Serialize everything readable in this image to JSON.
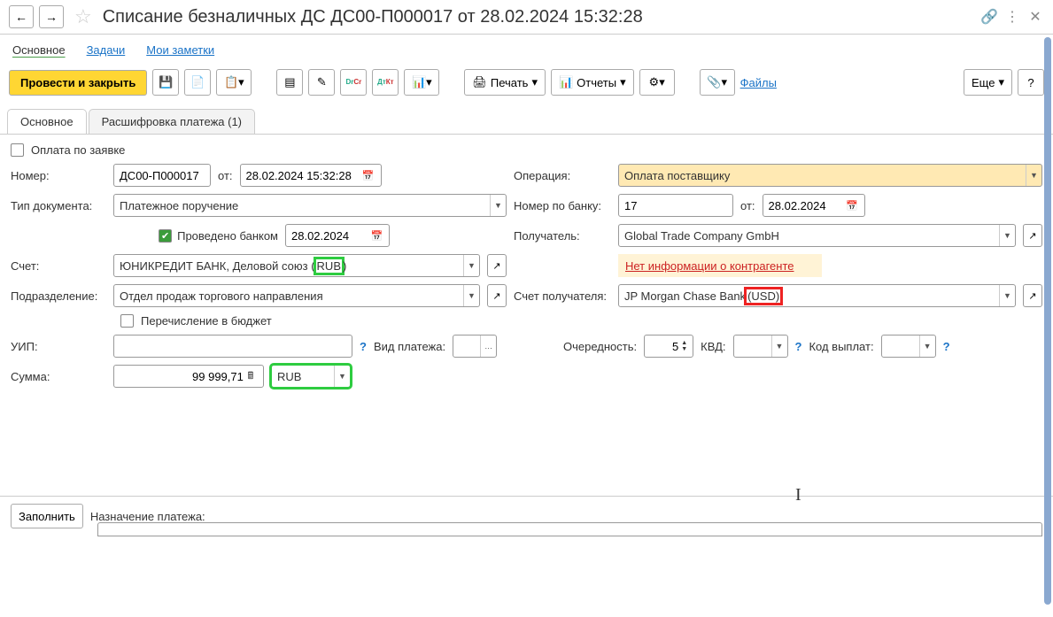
{
  "title": "Списание безналичных ДС ДС00-П000017 от 28.02.2024 15:32:28",
  "subnav": {
    "main": "Основное",
    "tasks": "Задачи",
    "notes": "Мои заметки"
  },
  "toolbar": {
    "post_close": "Провести и закрыть",
    "print": "Печать",
    "reports": "Отчеты",
    "files": "Файлы",
    "more": "Еще",
    "help": "?"
  },
  "tabs": {
    "main": "Основное",
    "detail": "Расшифровка платежа (1)"
  },
  "form": {
    "pay_by_request_label": "Оплата по заявке",
    "number_label": "Номер:",
    "number": "ДС00-П000017",
    "from_label": "от:",
    "datetime": "28.02.2024 15:32:28",
    "doctype_label": "Тип документа:",
    "doctype": "Платежное поручение",
    "bank_processed_label": "Проведено банком",
    "bank_date": "28.02.2024",
    "account_label": "Счет:",
    "account_prefix": "ЮНИКРЕДИТ БАНК, Деловой союз (",
    "account_cur": "RUB",
    "account_suffix": ")",
    "dept_label": "Подразделение:",
    "dept": "Отдел продаж торгового направления",
    "budget_transfer_label": "Перечисление в бюджет",
    "uip_label": "УИП:",
    "payment_type_label": "Вид платежа:",
    "sum_label": "Сумма:",
    "sum": "99 999,71",
    "currency": "RUB",
    "operation_label": "Операция:",
    "operation": "Оплата поставщику",
    "bank_num_label": "Номер по банку:",
    "bank_num": "17",
    "bank_num_date": "28.02.2024",
    "recipient_label": "Получатель:",
    "recipient": "Global Trade Company GmbH",
    "no_counterparty": "Нет информации о контрагенте",
    "recip_account_label": "Счет получателя:",
    "recip_account_prefix": "JP Morgan Chase Bank ",
    "recip_account_cur": "(USD)",
    "order_label": "Очередность:",
    "order": "5",
    "kvd_label": "КВД:",
    "payout_code_label": "Код выплат:",
    "fill_btn": "Заполнить",
    "purpose_label": "Назначение платежа:"
  }
}
